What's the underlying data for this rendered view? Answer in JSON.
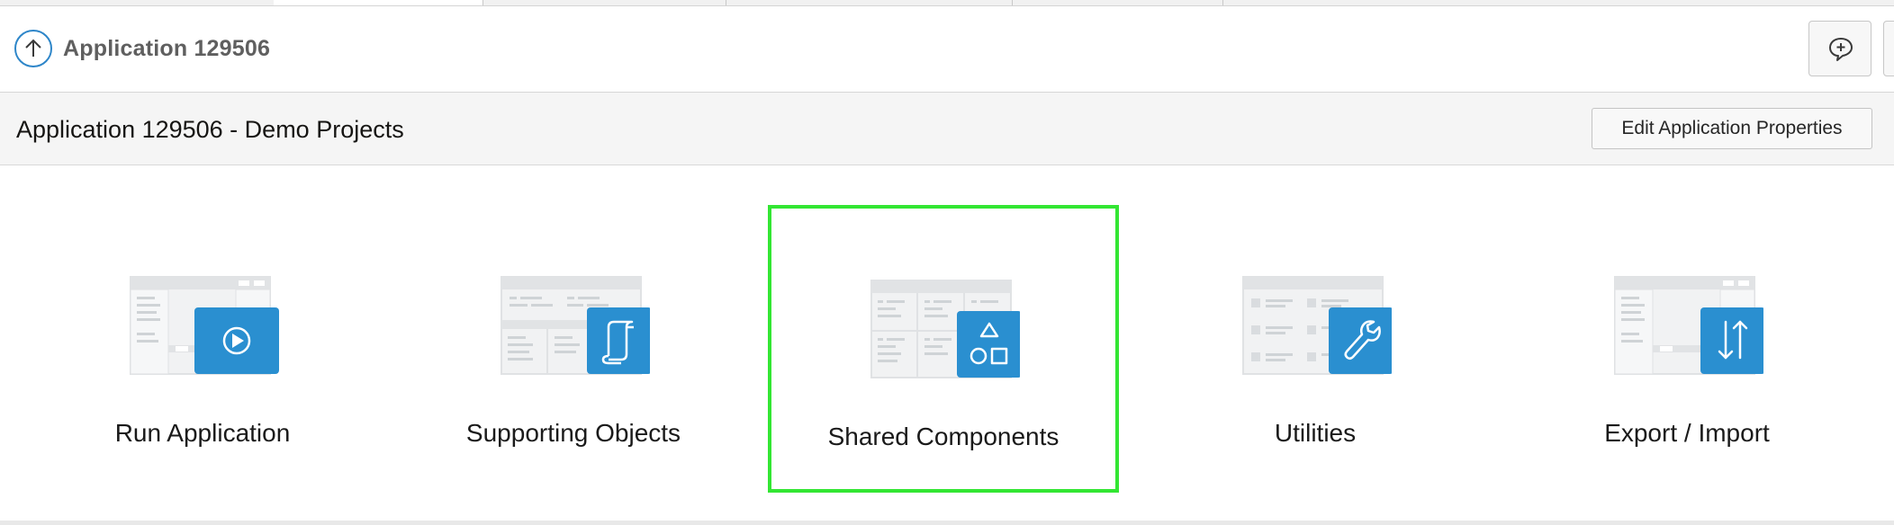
{
  "header": {
    "app_crumb": "Application 129506"
  },
  "title_region": {
    "title": "Application 129506 - Demo Projects",
    "edit_button_label": "Edit Application Properties"
  },
  "tiles": [
    {
      "label": "Run Application",
      "icon": "play-icon",
      "focused": false
    },
    {
      "label": "Supporting Objects",
      "icon": "scroll-icon",
      "focused": false
    },
    {
      "label": "Shared Components",
      "icon": "shapes-icon",
      "focused": true
    },
    {
      "label": "Utilities",
      "icon": "wrench-icon",
      "focused": false
    },
    {
      "label": "Export / Import",
      "icon": "transfer-arrows-icon",
      "focused": false
    }
  ],
  "colors": {
    "accent_blue": "#2a8fd0",
    "focus_outline": "#33e633",
    "wireframe_gray": "#e6e8ea"
  }
}
